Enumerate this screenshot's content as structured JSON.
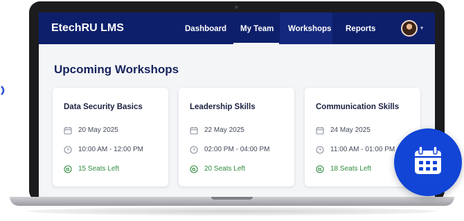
{
  "app": {
    "title": "EtechRU LMS"
  },
  "nav": {
    "items": [
      {
        "label": "Dashboard",
        "active": false
      },
      {
        "label": "My Team",
        "active": true
      },
      {
        "label": "Workshops",
        "active": false
      },
      {
        "label": "Reports",
        "active": false
      }
    ],
    "avatar_icon": "user-avatar"
  },
  "main": {
    "title": "Upcoming Workshops",
    "cards": [
      {
        "title": "Data Security Basics",
        "date": "20 May 2025",
        "time": "10:00 AM - 12:00 PM",
        "seats": "15 Seats Left"
      },
      {
        "title": "Leadership Skills",
        "date": "22 May 2025",
        "time": "02:00 PM - 04:00 PM",
        "seats": "20 Seats Left"
      },
      {
        "title": "Communication Skills",
        "date": "24 May 2025",
        "time": "11:00 AM - 01:00 PM",
        "seats": "18 Seats Left"
      }
    ]
  },
  "icons": {
    "date": "calendar-icon",
    "time": "clock-icon",
    "seats": "seat-icon",
    "badge": "calendar-badge-icon"
  },
  "colors": {
    "nav_bg": "#0d1f6b",
    "accent_blue": "#1245d6",
    "seats_green": "#2f8a3e",
    "title_text": "#17245c"
  }
}
